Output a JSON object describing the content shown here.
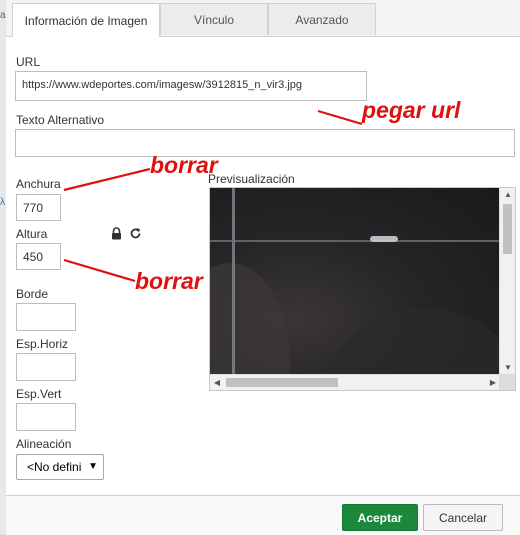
{
  "tabs": [
    {
      "label": "Información de Imagen",
      "active": true
    },
    {
      "label": "Vínculo",
      "active": false
    },
    {
      "label": "Avanzado",
      "active": false
    }
  ],
  "url": {
    "label": "URL",
    "value": "https://www.wdeportes.com/imagesw/3912815_n_vir3.jpg"
  },
  "alt_text": {
    "label": "Texto Alternativo",
    "value": ""
  },
  "width": {
    "label": "Anchura",
    "value": "770"
  },
  "height": {
    "label": "Altura",
    "value": "450"
  },
  "lock_icon": "lock-icon",
  "reset_icon": "reset-size-icon",
  "border": {
    "label": "Borde",
    "value": ""
  },
  "hspace": {
    "label": "Esp.Horiz",
    "value": ""
  },
  "vspace": {
    "label": "Esp.Vert",
    "value": ""
  },
  "align": {
    "label": "Alineación",
    "selected": "<No defini"
  },
  "preview": {
    "label": "Previsualización"
  },
  "buttons": {
    "ok": "Aceptar",
    "cancel": "Cancelar"
  },
  "annotations": {
    "paste_url": "pegar url",
    "delete_1": "borrar",
    "delete_2": "borrar"
  },
  "colors": {
    "accept": "#1a8a3a",
    "annotation": "#e01010"
  }
}
